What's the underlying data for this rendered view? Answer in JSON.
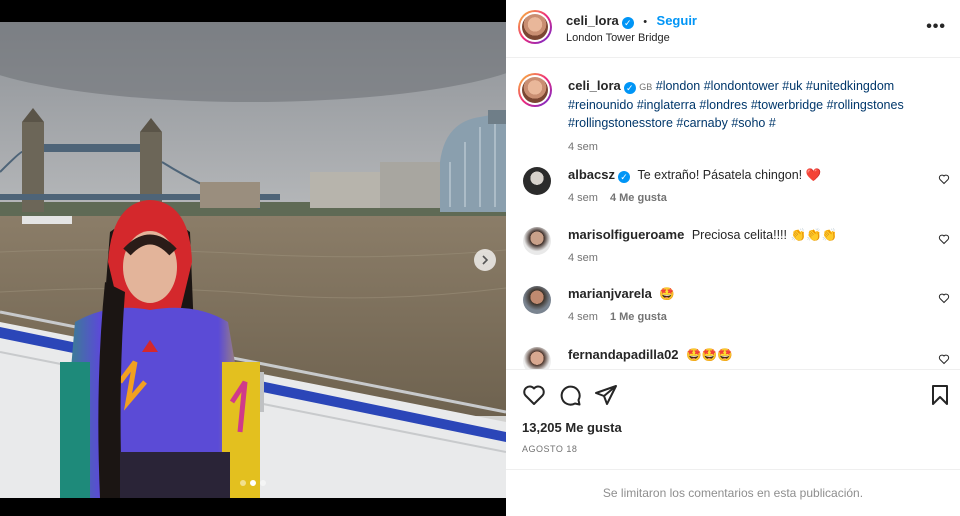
{
  "post": {
    "username": "celi_lora",
    "follow_label": "Seguir",
    "separator": "•",
    "location": "London Tower Bridge",
    "more_label": "•••"
  },
  "caption": {
    "username": "celi_lora",
    "flag": "GB",
    "hashtags": [
      "#london",
      "#londontower",
      "#uk",
      "#unitedkingdom",
      "#reinounido",
      "#inglaterra",
      "#londres",
      "#towerbridge",
      "#rollingstones",
      "#rollingstonesstore",
      "#carnaby",
      "#soho",
      "#"
    ],
    "time": "4 sem"
  },
  "comments": [
    {
      "username": "albacsz",
      "text": "Te extraño! Pásatela chingon! ❤️",
      "time": "4 sem",
      "likes": "4 Me gusta",
      "verified": true
    },
    {
      "username": "marisolfigueroame",
      "text": "Preciosa celita!!!! 👏👏👏",
      "time": "4 sem",
      "likes": "",
      "verified": false
    },
    {
      "username": "marianjvarela",
      "text": "🤩",
      "time": "4 sem",
      "likes": "1 Me gusta",
      "verified": false
    },
    {
      "username": "fernandapadilla02",
      "text": "🤩🤩🤩",
      "time": "",
      "likes": "",
      "verified": false
    }
  ],
  "stats": {
    "likes": "13,205 Me gusta",
    "date": "AGOSTO 18"
  },
  "footer": {
    "text": "Se limitaron los comentarios en esta publicación."
  },
  "icons": {
    "like": "heart-icon",
    "comment": "comment-icon",
    "share": "share-icon",
    "save": "bookmark-icon",
    "next": "chevron-right-icon"
  },
  "colors": {
    "accent": "#0095f6",
    "hashtag": "#00376b",
    "muted": "#737373"
  },
  "carousel": {
    "total": 3,
    "active": 1
  }
}
